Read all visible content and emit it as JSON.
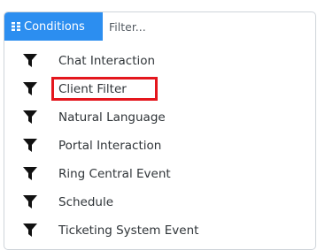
{
  "toolbar": {
    "conditions_label": "Conditions",
    "filter_placeholder": "Filter...",
    "accent_color": "#2c8ef0"
  },
  "list": {
    "items": [
      {
        "label": "Chat Interaction",
        "icon": "funnel-icon"
      },
      {
        "label": "Client Filter",
        "icon": "funnel-icon",
        "highlighted": true
      },
      {
        "label": "Natural Language",
        "icon": "funnel-icon"
      },
      {
        "label": "Portal Interaction",
        "icon": "funnel-icon"
      },
      {
        "label": "Ring Central Event",
        "icon": "funnel-icon"
      },
      {
        "label": "Schedule",
        "icon": "funnel-icon"
      },
      {
        "label": "Ticketing System Event",
        "icon": "funnel-icon"
      }
    ],
    "highlight_color": "#e4161d"
  }
}
